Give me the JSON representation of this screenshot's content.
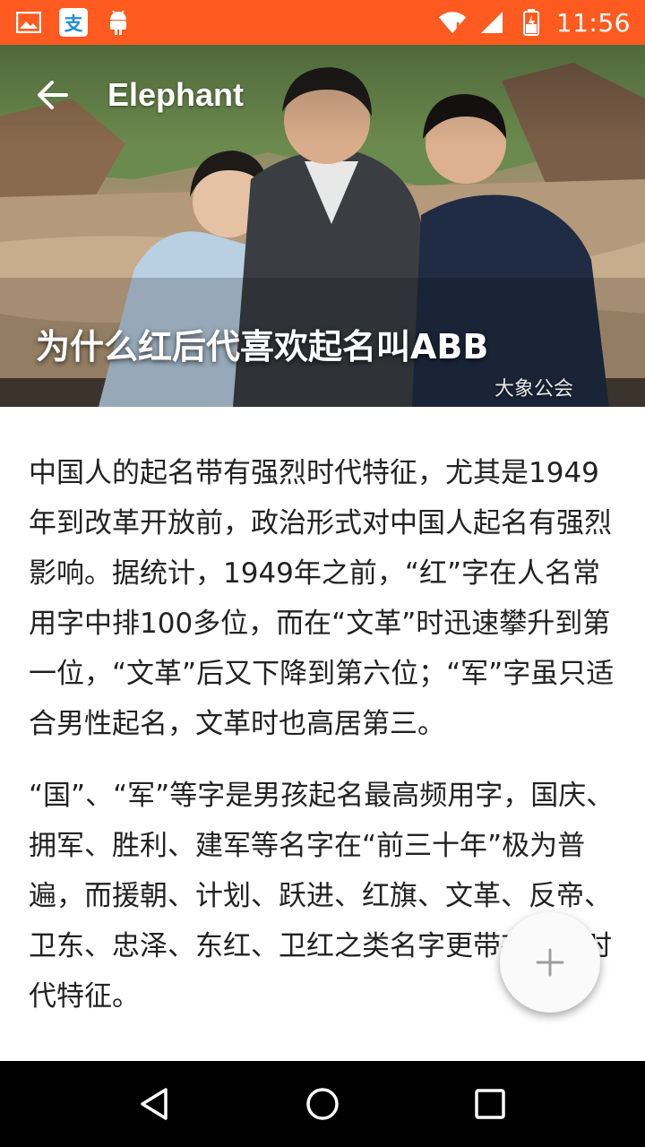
{
  "status_bar": {
    "time": "11:56",
    "left_icons": [
      "image-icon",
      "alipay-icon",
      "android-icon"
    ],
    "right_icons": [
      "wifi-icon",
      "signal-icon",
      "battery-icon"
    ],
    "background": "#ff5a1f"
  },
  "toolbar": {
    "title": "Elephant"
  },
  "hero": {
    "title": "为什么红后代喜欢起名叫ABB",
    "watermark": "大象公会"
  },
  "article": {
    "paragraphs": [
      "中国人的起名带有强烈时代特征，尤其是1949年到改革开放前，政治形式对中国人起名有强烈影响。据统计，1949年之前，“红”字在人名常用字中排100多位，而在“文革”时迅速攀升到第一位，“文革”后又下降到第六位；“军”字虽只适合男性起名，文革时也高居第三。",
      "“国”、“军”等字是男孩起名最高频用字，国庆、拥军、胜利、建军等名字在“前三十年”极为普遍，而援朝、计划、跃进、红旗、文革、反帝、卫东、忠泽、东红、卫红之类名字更带有强烈时代特征。"
    ]
  },
  "fab": {
    "icon": "plus-icon"
  },
  "nav_bar": {
    "buttons": [
      "back-icon",
      "home-icon",
      "recents-icon"
    ]
  }
}
